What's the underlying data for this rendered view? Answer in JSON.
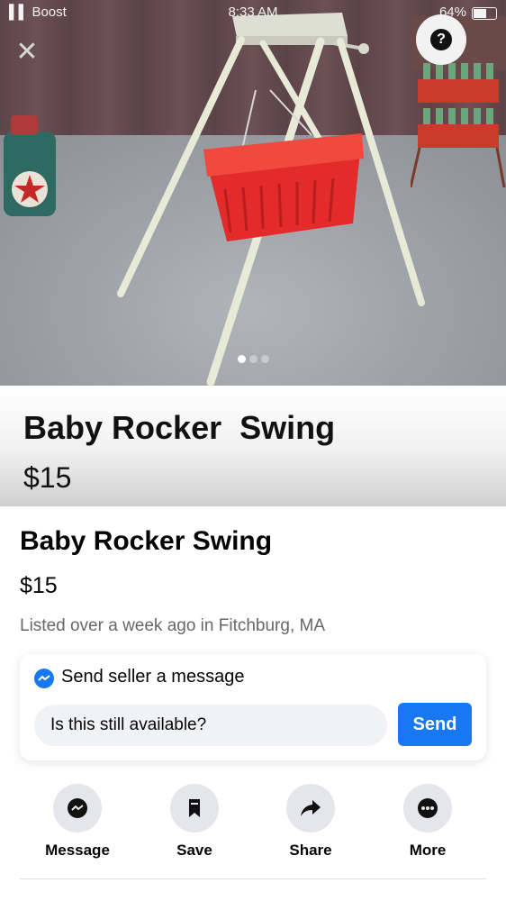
{
  "status_bar": {
    "carrier": "Boost",
    "time": "8:33 AM",
    "battery": "64%",
    "battery_level": 0.64
  },
  "photo": {
    "carousel_count": 3,
    "active_index": 0
  },
  "header_band": {
    "title": "Baby Rocker  Swing",
    "price": "$15"
  },
  "listing": {
    "title": "Baby Rocker Swing",
    "price": "$15",
    "meta": "Listed over a week ago in Fitchburg, MA"
  },
  "message_card": {
    "heading": "Send seller a message",
    "input_value": "Is this still available?",
    "send_label": "Send"
  },
  "actions": [
    {
      "label": "Message",
      "icon": "messenger-icon"
    },
    {
      "label": "Save",
      "icon": "bookmark-icon"
    },
    {
      "label": "Share",
      "icon": "share-arrow-icon"
    },
    {
      "label": "More",
      "icon": "more-dots-icon"
    }
  ],
  "colors": {
    "accent": "#1877f2",
    "basket": "#e32b2b",
    "frame": "#e8ead8"
  }
}
